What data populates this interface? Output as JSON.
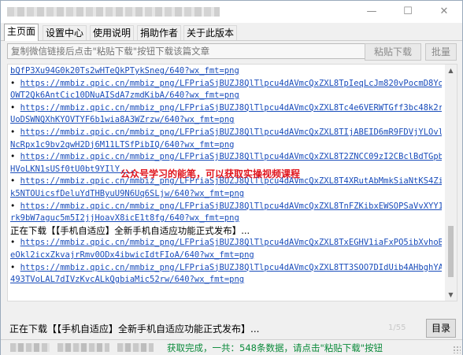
{
  "menu": {
    "tabs": [
      {
        "label": "主页面"
      },
      {
        "label": "设置中心"
      },
      {
        "label": "使用说明"
      },
      {
        "label": "捐助作者"
      },
      {
        "label": "关于此版本"
      }
    ]
  },
  "window_controls": {
    "minimize": "—",
    "maximize": "☐",
    "close": "✕"
  },
  "toolbar": {
    "url_placeholder": "复制微信链接后点击\"粘贴下载\"按钮下载该篇文章",
    "paste_download_label": "粘贴下载",
    "batch_label": "批量"
  },
  "log": {
    "lines": [
      {
        "kind": "cont",
        "text": "bQfP3Xu94G0k20Ts2wHTeQkPTykSneg/640?wx_fmt=png"
      },
      {
        "kind": "url",
        "text": "https://mmbiz.qpic.cn/mmbiz_png/LFPriaSjBUZJ8QlTlpcu4dAVmcQxZXL8TpIeqLcJm820vPocmD8YoTuqNY"
      },
      {
        "kind": "cont",
        "text": "OWT2Qk6AntCic10DNuAISdA7zmdKibA/640?wx_fmt=png"
      },
      {
        "kind": "url",
        "text": "https://mmbiz.qpic.cn/mmbiz_png/LFPriaSjBUZJ8QlTlpcu4dAVmcQxZXL8Tc4e6VERWTGff3bc48k2rHqBqu"
      },
      {
        "kind": "cont",
        "text": "UoDSWNQXhKYOVTYF6b1wia8A3WZrzw/640?wx_fmt=png"
      },
      {
        "kind": "url",
        "text": "https://mmbiz.qpic.cn/mmbiz_png/LFPriaSjBUZJ8QlTlpcu4dAVmcQxZXL8TIjABEID6mR9FDVjYLOvlExnYQ"
      },
      {
        "kind": "cont",
        "text": "NcRpx1c9bv2qwH2Dj6M11LTSfPibIQ/640?wx_fmt=png"
      },
      {
        "kind": "url",
        "text": "https://mmbiz.qpic.cn/mmbiz_png/LFPriaSjBUZJ8QlTlpcu4dAVmcQxZXL8T2ZNCC09zI2CBclBdTGpbzgbB4"
      },
      {
        "kind": "cont",
        "text": "HVoLKN1sUSf0tU0bt9YIlY..."
      },
      {
        "kind": "url",
        "text": "https://mmbiz.qpic.cn/mmbiz_png/LFPriaSjBUZJ8QlTlpcu4dAVmcQxZXL8T4XRutAbMmkSiaNtKS4ZiaA4Nh"
      },
      {
        "kind": "cont",
        "text": "k5NTOUicsfDeluYdTHByuU9N6Uq6SLjw/640?wx_fmt=png"
      },
      {
        "kind": "url",
        "text": "https://mmbiz.qpic.cn/mmbiz_png/LFPriaSjBUZJ8QlTlpcu4dAVmcQxZXL8TnFZKibxEWSOPSaVvXYY1et78C"
      },
      {
        "kind": "cont",
        "text": "rk9bW7aguc5m5I2jjHoavX8icE1t8fg/640?wx_fmt=png"
      },
      {
        "kind": "dl",
        "text": "正在下载【【手机自适应】全新手机自适应功能正式发布】..."
      },
      {
        "kind": "url",
        "text": "https://mmbiz.qpic.cn/mmbiz_png/LFPriaSjBUZJ8QlTlpcu4dAVmcQxZXL8TxEGHV1iaFxPO5ibXvhoBLRQT7"
      },
      {
        "kind": "cont",
        "text": "eOkl2icxZkvajrRmv0ODx4ibwicIdtFIoA/640?wx_fmt=png"
      },
      {
        "kind": "url",
        "text": "https://mmbiz.qpic.cn/mmbiz_png/LFPriaSjBUZJ8QlTlpcu4dAVmcQxZXL8TT3SOO7DIdUib4AHbghYA5BJYY"
      },
      {
        "kind": "cont",
        "text": "493TVoLAL7dIVzKvcALkQgbiaMic52rw/640?wx_fmt=png"
      }
    ],
    "overlay_text": "公众号学习的能笔，可以获取实操视频课程"
  },
  "status": {
    "current": "正在下载【【手机自适应】全新手机自适应功能正式发布】...",
    "progress_text": "1/55",
    "dir_button_label": "目录",
    "message": "获取完成，一共：548条数据，请点击\"粘贴下载\"按钮"
  }
}
